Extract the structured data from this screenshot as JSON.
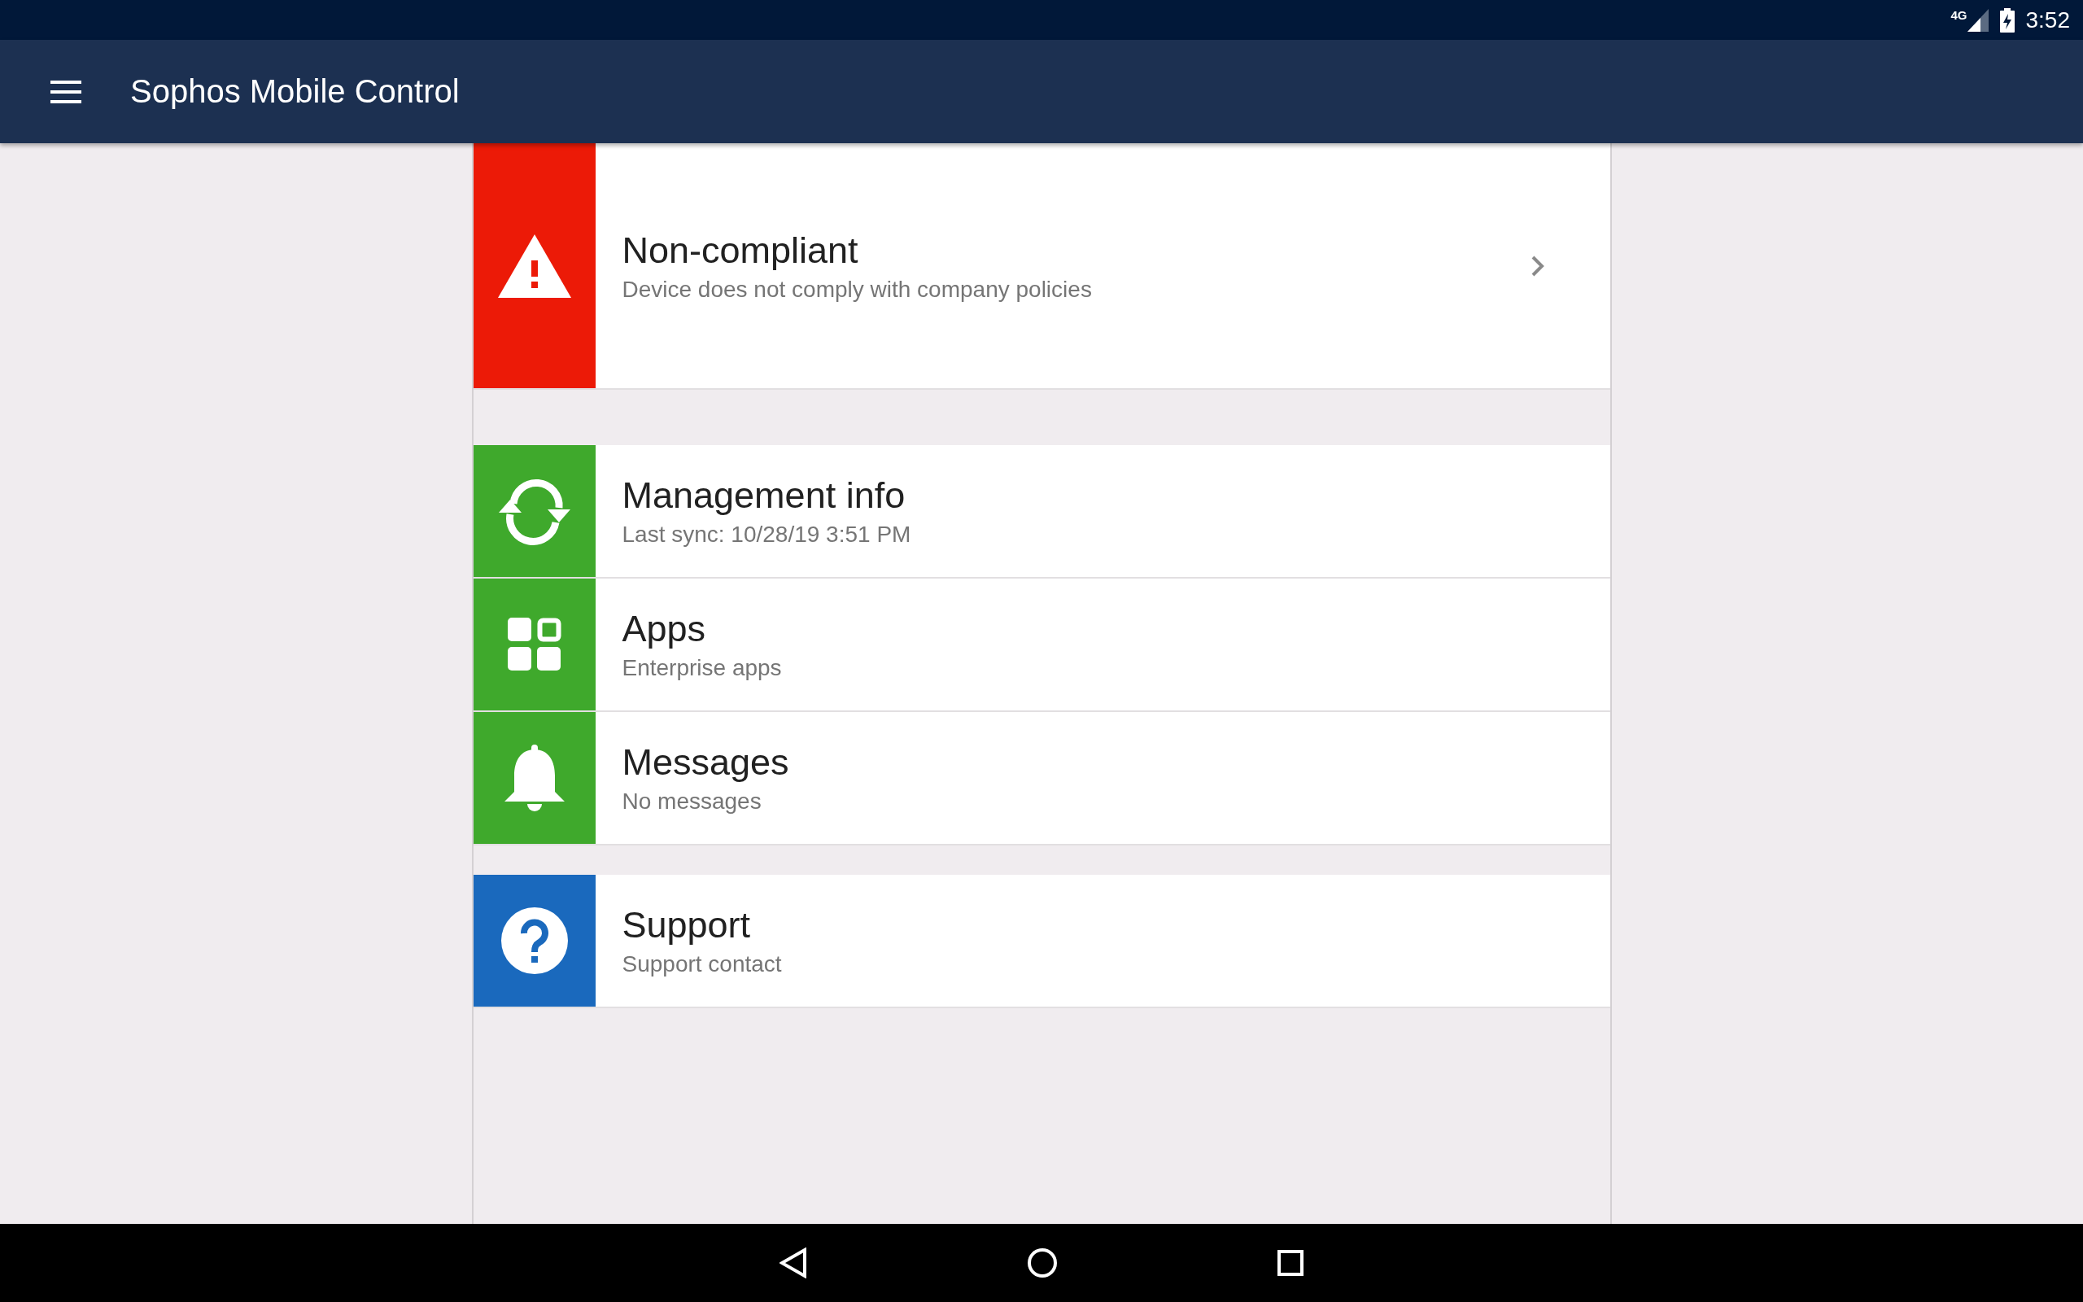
{
  "status_bar": {
    "network": "4G",
    "time": "3:52"
  },
  "toolbar": {
    "title": "Sophos Mobile Control"
  },
  "sections": [
    {
      "items": [
        {
          "kind": "warning",
          "color": "#ec1a07",
          "title": "Non-compliant",
          "subtitle": "Device does not comply with company policies",
          "chevron": true
        }
      ]
    },
    {
      "items": [
        {
          "kind": "sync",
          "color": "#3fa92c",
          "title": "Management info",
          "subtitle": "Last sync: 10/28/19 3:51 PM",
          "chevron": false
        },
        {
          "kind": "apps",
          "color": "#3fa92c",
          "title": "Apps",
          "subtitle": "Enterprise apps",
          "chevron": false
        },
        {
          "kind": "bell",
          "color": "#3fa92c",
          "title": "Messages",
          "subtitle": "No messages",
          "chevron": false
        }
      ]
    },
    {
      "items": [
        {
          "kind": "help",
          "color": "#1a69bd",
          "title": "Support",
          "subtitle": "Support contact",
          "chevron": false
        }
      ]
    }
  ]
}
